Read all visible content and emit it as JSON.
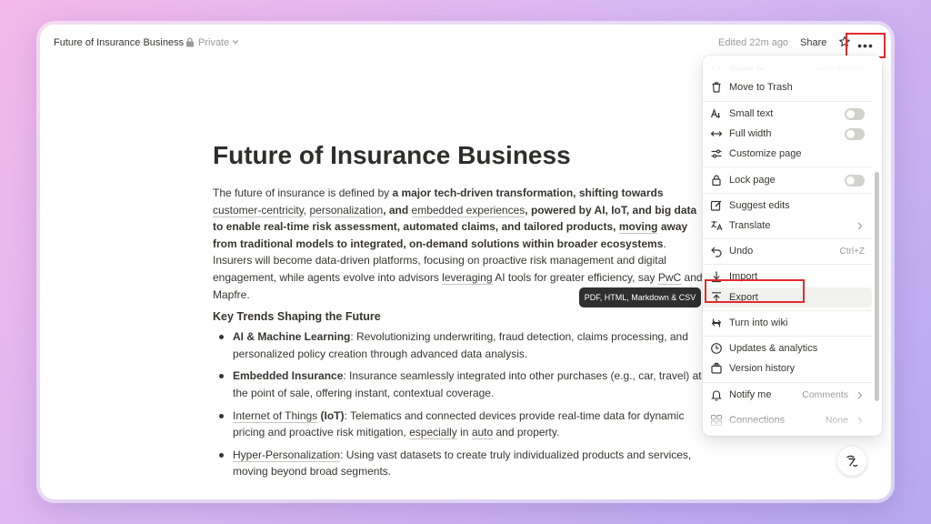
{
  "header": {
    "title": "Future of Insurance Business",
    "visibility": "Private",
    "edited": "Edited 22m ago",
    "share_label": "Share",
    "icons": [
      "lock-icon",
      "chevron-down-icon",
      "star-icon",
      "more-icon"
    ]
  },
  "document": {
    "title": "Future of Insurance Business",
    "intro": {
      "p1": "The future of insurance is defined by ",
      "b1": "a major tech-driven transformation, shifting towards ",
      "l1": "customer-centricity",
      "t1": ", ",
      "l2": "personalization",
      "b2": ", and ",
      "l3": "embedded experiences",
      "b3": ", powered by AI, IoT, and big data to enable real-time risk assessment, automated claims, and tailored products, ",
      "l4": "moving",
      "b4": " away from traditional models to integrated, on-demand solutions within broader ecosystems",
      "t2": ". Insurers will become data-driven platforms, focusing on proactive risk management and digital engagement, while agents evolve into advisors ",
      "l5": "leveraging",
      "t3": " AI tools for greater efficiency, say ",
      "l6": "PwC",
      "t4": " and Mapfre."
    },
    "subheading": "Key Trends Shaping the Future",
    "trends": [
      {
        "head": "AI & Machine Learning",
        "sep": ": ",
        "text": "Revolutionizing underwriting, fraud detection, claims processing, and personalized policy creation through advanced data analysis."
      },
      {
        "head": "Embedded Insurance",
        "sep": ": ",
        "text": "Insurance seamlessly integrated into other purchases (e.g., car, travel) at the point of sale, offering instant, contextual coverage."
      },
      {
        "head": "Internet of Things",
        "head_b": " (IoT)",
        "sep": ": ",
        "text_a": "Telematics and connected devices provide real-time data for dynamic pricing and proactive risk mitigation, ",
        "link_a": "especially",
        "text_b": " in ",
        "link_b": "auto",
        "text_c": " and property."
      },
      {
        "head": "Hyper-Personalization",
        "sep": ": ",
        "text": "Using vast datasets to create truly individualized products and services, moving beyond broad segments."
      }
    ]
  },
  "tooltip": "PDF, HTML, Markdown & CSV",
  "menu": {
    "move_to": {
      "label": "Move to",
      "shortcut": "Ctrl+Shift+P"
    },
    "move_to_trash": {
      "label": "Move to Trash"
    },
    "small_text": {
      "label": "Small text"
    },
    "full_width": {
      "label": "Full width"
    },
    "customize_page": {
      "label": "Customize page"
    },
    "lock_page": {
      "label": "Lock page"
    },
    "suggest_edits": {
      "label": "Suggest edits"
    },
    "translate": {
      "label": "Translate"
    },
    "undo": {
      "label": "Undo",
      "shortcut": "Ctrl+Z"
    },
    "import": {
      "label": "Import"
    },
    "export": {
      "label": "Export"
    },
    "turn_into_wiki": {
      "label": "Turn into wiki"
    },
    "updates_analytics": {
      "label": "Updates & analytics"
    },
    "version_history": {
      "label": "Version history"
    },
    "notify_me": {
      "label": "Notify me",
      "value": "Comments"
    },
    "connections": {
      "label": "Connections",
      "value": "None"
    }
  },
  "colors": {
    "highlight": "#e02b2b",
    "text": "#37352f",
    "muted": "#9b9a97",
    "tooltip_bg": "#2f2f2f"
  }
}
